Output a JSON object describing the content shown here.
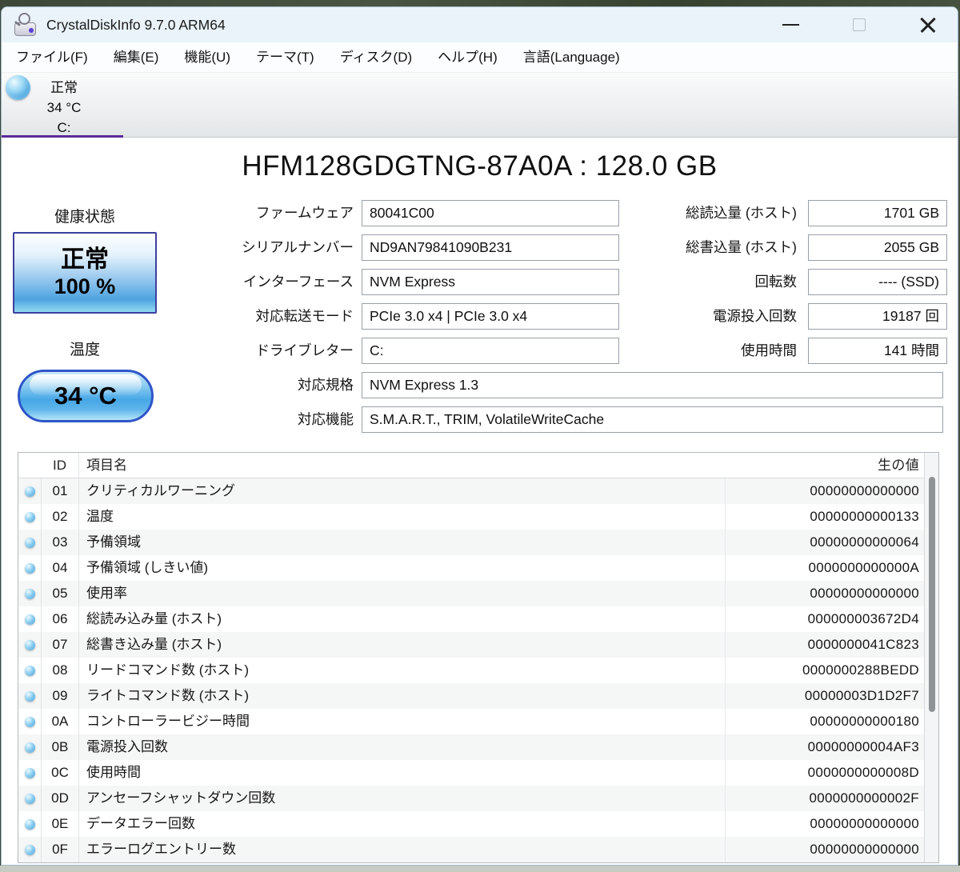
{
  "window": {
    "title": "CrystalDiskInfo 9.7.0 ARM64"
  },
  "menu": {
    "items": [
      {
        "label": "ファイル(F)"
      },
      {
        "label": "編集(E)"
      },
      {
        "label": "機能(U)"
      },
      {
        "label": "テーマ(T)"
      },
      {
        "label": "ディスク(D)"
      },
      {
        "label": "ヘルプ(H)"
      },
      {
        "label": "言語(Language)"
      }
    ]
  },
  "drive_tab": {
    "status": "正常",
    "temperature": "34 °C",
    "letter": "C:"
  },
  "drive": {
    "title": "HFM128GDGTNG-87A0A : 128.0 GB",
    "health": {
      "label": "健康状態",
      "status": "正常",
      "percent": "100 %"
    },
    "temperature": {
      "label": "温度",
      "value": "34 °C"
    },
    "fields_mid": [
      {
        "label": "ファームウェア",
        "value": "80041C00"
      },
      {
        "label": "シリアルナンバー",
        "value": "ND9AN79841090B231"
      },
      {
        "label": "インターフェース",
        "value": "NVM Express"
      },
      {
        "label": "対応転送モード",
        "value": "PCIe 3.0 x4 | PCIe 3.0 x4"
      },
      {
        "label": "ドライブレター",
        "value": "C:"
      }
    ],
    "fields_wide": [
      {
        "label": "対応規格",
        "value": "NVM Express 1.3"
      },
      {
        "label": "対応機能",
        "value": "S.M.A.R.T., TRIM, VolatileWriteCache"
      }
    ],
    "fields_right": [
      {
        "label": "総読込量 (ホスト)",
        "value": "1701 GB"
      },
      {
        "label": "総書込量 (ホスト)",
        "value": "2055 GB"
      },
      {
        "label": "回転数",
        "value": "---- (SSD)"
      },
      {
        "label": "電源投入回数",
        "value": "19187 回"
      },
      {
        "label": "使用時間",
        "value": "141 時間"
      }
    ]
  },
  "smart_table": {
    "headers": {
      "id": "ID",
      "name": "項目名",
      "raw": "生の値"
    },
    "rows": [
      {
        "id": "01",
        "name": "クリティカルワーニング",
        "raw": "00000000000000"
      },
      {
        "id": "02",
        "name": "温度",
        "raw": "00000000000133"
      },
      {
        "id": "03",
        "name": "予備領域",
        "raw": "00000000000064"
      },
      {
        "id": "04",
        "name": "予備領域 (しきい値)",
        "raw": "0000000000000A"
      },
      {
        "id": "05",
        "name": "使用率",
        "raw": "00000000000000"
      },
      {
        "id": "06",
        "name": "総読み込み量 (ホスト)",
        "raw": "000000003672D4"
      },
      {
        "id": "07",
        "name": "総書き込み量 (ホスト)",
        "raw": "0000000041C823"
      },
      {
        "id": "08",
        "name": "リードコマンド数 (ホスト)",
        "raw": "0000000288BEDD"
      },
      {
        "id": "09",
        "name": "ライトコマンド数 (ホスト)",
        "raw": "00000003D1D2F7"
      },
      {
        "id": "0A",
        "name": "コントローラービジー時間",
        "raw": "00000000000180"
      },
      {
        "id": "0B",
        "name": "電源投入回数",
        "raw": "00000000004AF3"
      },
      {
        "id": "0C",
        "name": "使用時間",
        "raw": "0000000000008D"
      },
      {
        "id": "0D",
        "name": "アンセーフシャットダウン回数",
        "raw": "0000000000002F"
      },
      {
        "id": "0E",
        "name": "データエラー回数",
        "raw": "00000000000000"
      },
      {
        "id": "0F",
        "name": "エラーログエントリー数",
        "raw": "00000000000000"
      }
    ]
  },
  "colors": {
    "titlebar_bg": "#e9f3f9",
    "tab_accent_purple": "#5b2a9b",
    "health_box_blue": "#4da3e0",
    "health_border": "#3d3f9e",
    "temp_border": "#2f55c8",
    "status_good_sphere": "#47a5de"
  }
}
